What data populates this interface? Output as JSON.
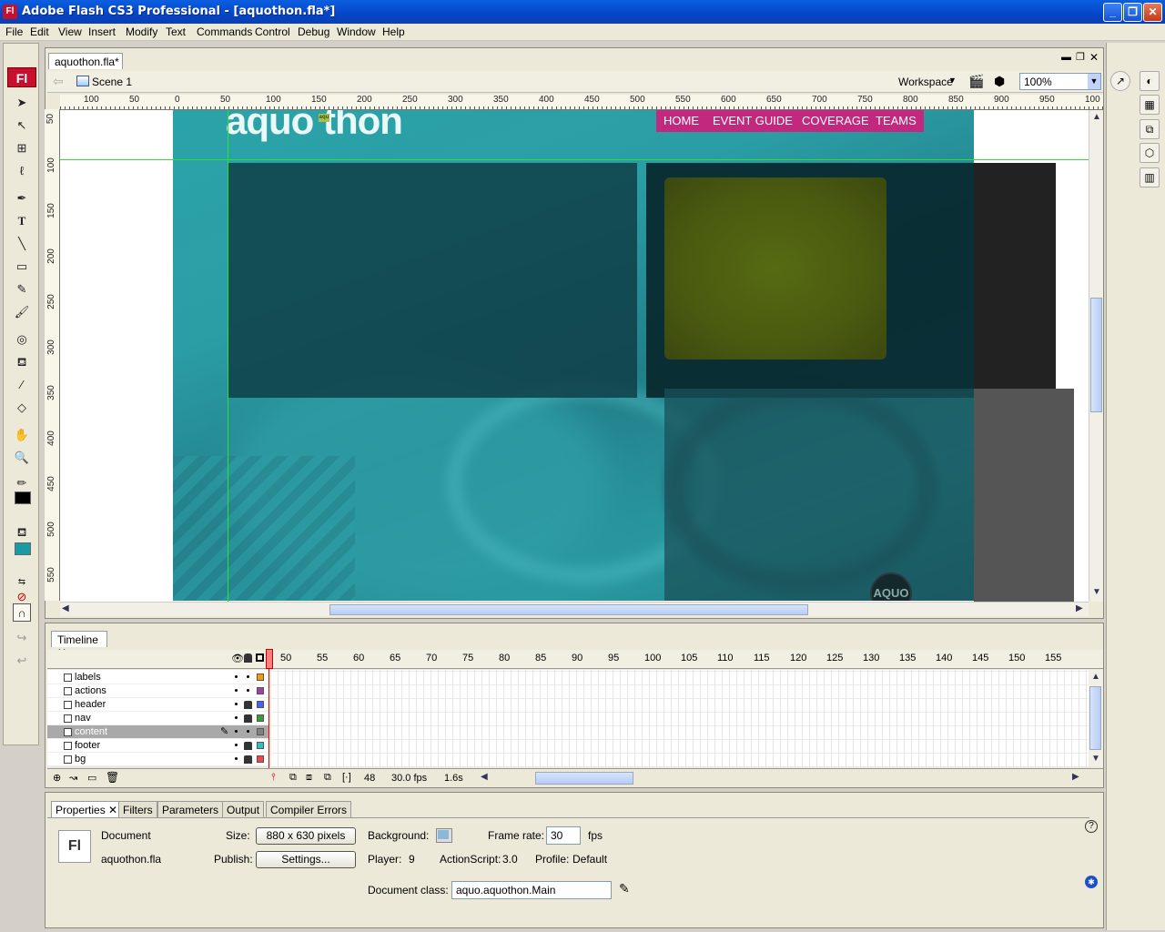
{
  "window": {
    "title": "Adobe Flash CS3 Professional - [aquothon.fla*]",
    "app_icon": "Fl"
  },
  "menu": [
    "File",
    "Edit",
    "View",
    "Insert",
    "Modify",
    "Text",
    "Commands",
    "Control",
    "Debug",
    "Window",
    "Help"
  ],
  "document": {
    "tab": "aquothon.fla*",
    "scene": "Scene 1",
    "workspace_label": "Workspace",
    "zoom": "100%",
    "hruler": [
      "100",
      "50",
      "0",
      "50",
      "100",
      "150",
      "200",
      "250",
      "300",
      "350",
      "400",
      "450",
      "500",
      "550",
      "600",
      "650",
      "700",
      "750",
      "800",
      "850",
      "900",
      "950",
      "100"
    ],
    "vruler": [
      "50",
      "100",
      "150",
      "200",
      "250",
      "300",
      "350",
      "400",
      "450",
      "500",
      "550"
    ]
  },
  "stage": {
    "logo": "aquo thon",
    "logo_mid": "aqu",
    "nav": [
      "HOME",
      "EVENT GUIDE",
      "COVERAGE",
      "TEAMS"
    ],
    "badge": "AQUO",
    "colors": {
      "teal": "#2aa3a8",
      "nav_bg": "#c1287e",
      "olive": "#4a5a10",
      "panel_dark": "#082a30"
    }
  },
  "timeline": {
    "tab": "Timeline",
    "frame_numbers": [
      "50",
      "55",
      "60",
      "65",
      "70",
      "75",
      "80",
      "85",
      "90",
      "95",
      "100",
      "105",
      "110",
      "115",
      "120",
      "125",
      "130",
      "135",
      "140",
      "145",
      "150",
      "155"
    ],
    "layers": [
      {
        "name": "labels",
        "locked": false,
        "color": "#ff9900"
      },
      {
        "name": "actions",
        "locked": false,
        "color": "#a040a0"
      },
      {
        "name": "header",
        "locked": true,
        "color": "#4060ff"
      },
      {
        "name": "nav",
        "locked": true,
        "color": "#30a030"
      },
      {
        "name": "content",
        "locked": false,
        "color": "#808080",
        "selected": true
      },
      {
        "name": "footer",
        "locked": true,
        "color": "#30c0c0"
      },
      {
        "name": "bg",
        "locked": true,
        "color": "#ff4040"
      }
    ],
    "current_frame": "48",
    "fps": "30.0 fps",
    "time": "1.6s"
  },
  "properties": {
    "tabs": [
      "Properties",
      "Filters",
      "Parameters",
      "Output",
      "Compiler Errors"
    ],
    "type": "Document",
    "filename": "aquothon.fla",
    "size_label": "Size:",
    "size_value": "880 x 630 pixels",
    "publish_label": "Publish:",
    "publish_button": "Settings...",
    "background_label": "Background:",
    "framerate_label": "Frame rate:",
    "framerate_value": "30",
    "fps_unit": "fps",
    "player_label": "Player:",
    "player_value": "9",
    "actionscript_label": "ActionScript:",
    "actionscript_value": "3.0",
    "profile_label": "Profile:",
    "profile_value": "Default",
    "docclass_label": "Document class:",
    "docclass_value": "aquo.aquothon.Main"
  }
}
